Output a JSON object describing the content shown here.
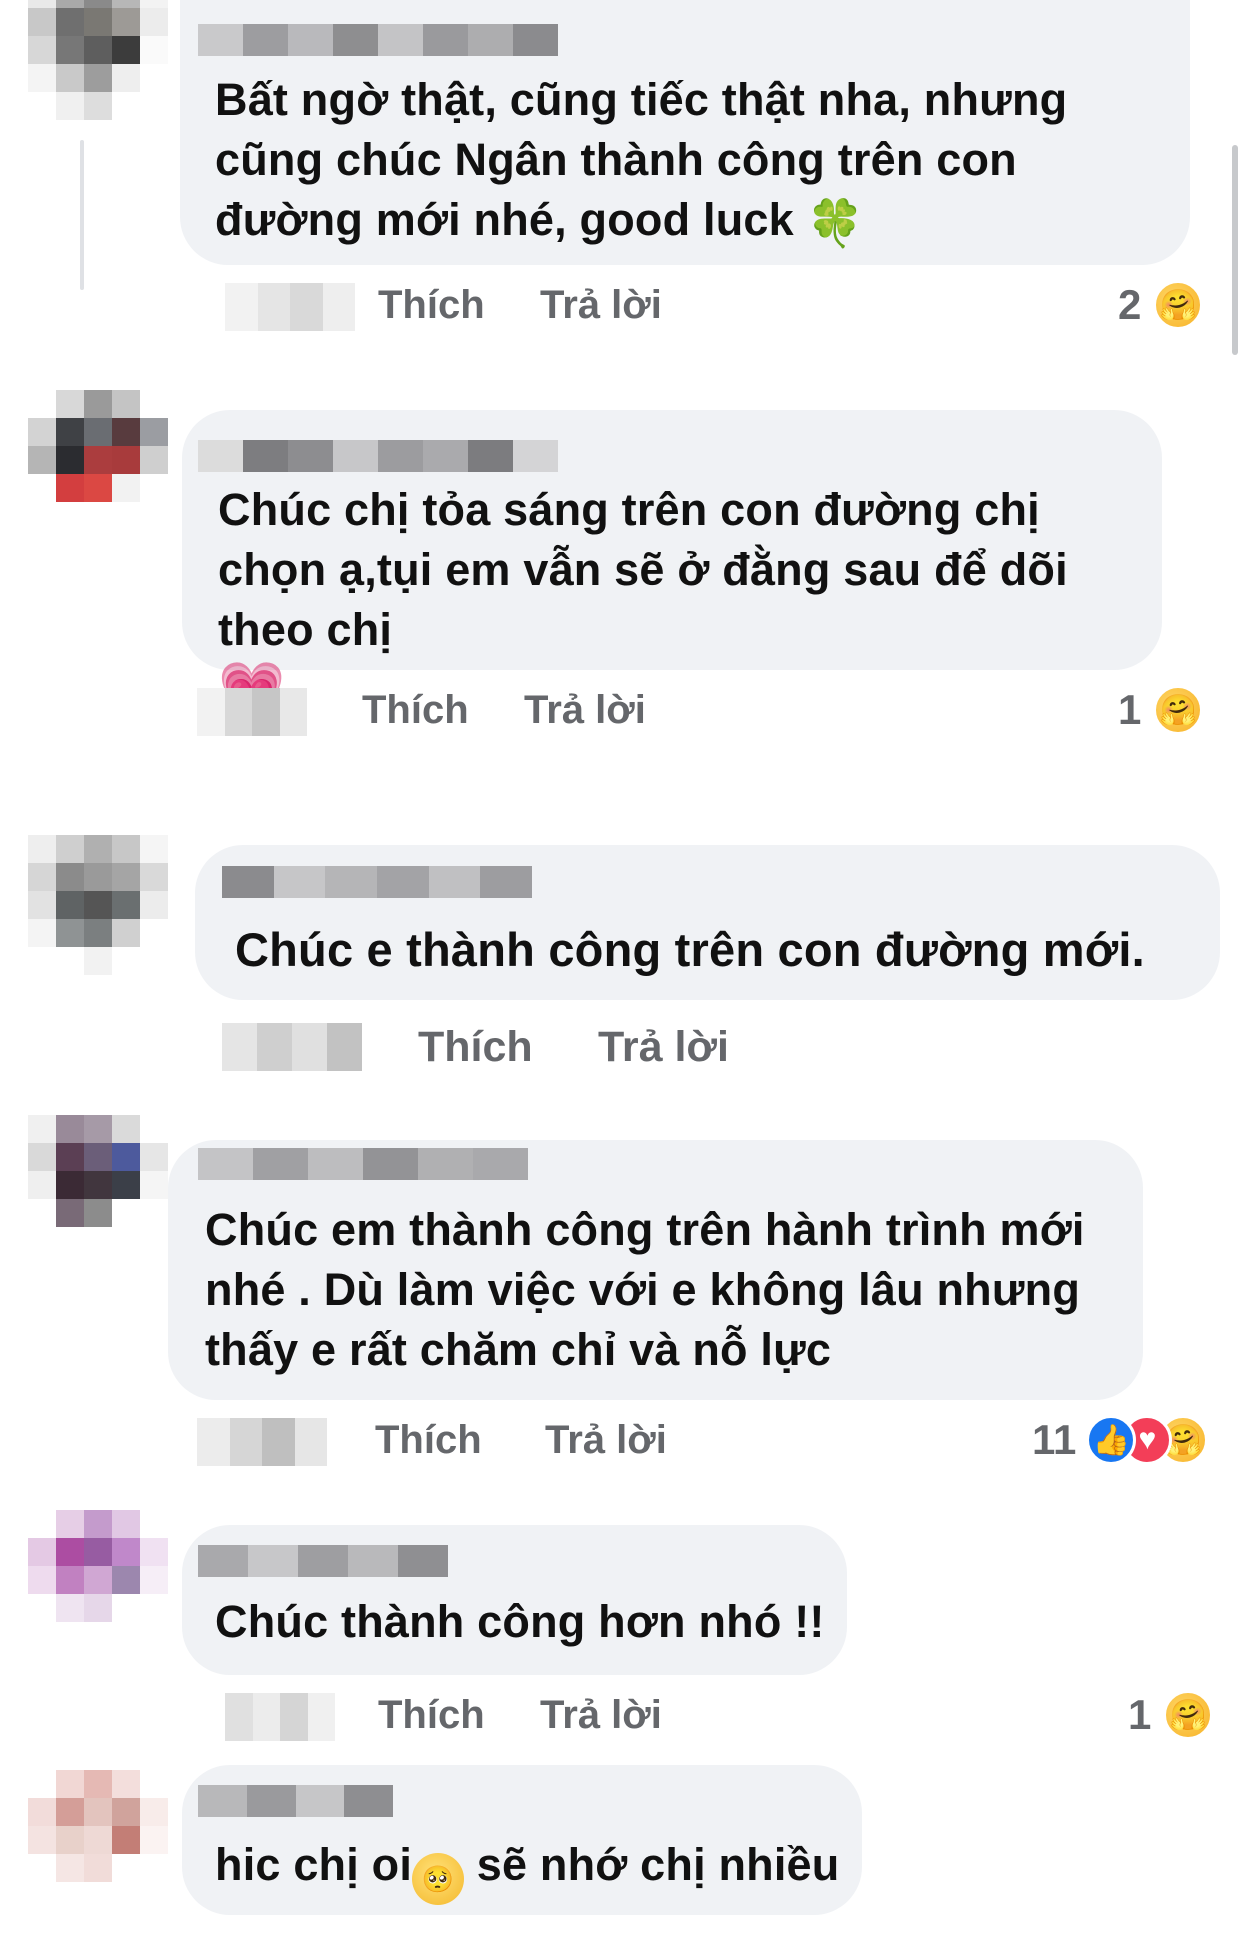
{
  "actions": {
    "like": "Thích",
    "reply": "Trả lời"
  },
  "comments": [
    {
      "text": "Bất ngờ thật, cũng tiếc thật nha, nhưng cũng chúc Ngân thành công trên con đường mới nhé, good luck",
      "inline_emoji": "🍀",
      "reaction_count": "2",
      "reactions": [
        "care"
      ]
    },
    {
      "text": "Chúc chị tỏa sáng trên con đường chị chọn ạ,tụi em vẫn sẽ ở đằng sau để dõi theo chị",
      "inline_emoji": "💗",
      "reaction_count": "1",
      "reactions": [
        "care"
      ]
    },
    {
      "text": "Chúc e thành công trên con đường mới.",
      "reaction_count": "",
      "reactions": []
    },
    {
      "text": "Chúc em thành công trên hành trình mới nhé . Dù làm việc với e không lâu nhưng thấy e rất chăm chỉ và nỗ lực",
      "reaction_count": "11",
      "reactions": [
        "like",
        "love",
        "care"
      ]
    },
    {
      "text": "Chúc thành công hơn nhó !!",
      "reaction_count": "1",
      "reactions": [
        "care"
      ]
    },
    {
      "text_before": "hic chị oi",
      "inline_emoji": "🥺",
      "text_after": " sẽ nhớ chị nhiều"
    }
  ],
  "colors": {
    "bubble": "#f0f2f5",
    "action_text": "#65676b",
    "like_blue": "#1877f2",
    "love_red": "#f33e58"
  }
}
